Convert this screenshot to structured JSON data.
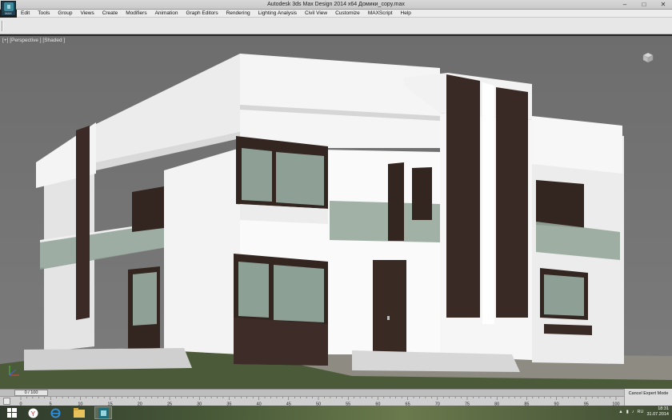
{
  "window": {
    "title": "Autodesk 3ds Max Design 2014 x64   Домики_copy.max",
    "app_icon_caption": "MAX",
    "controls": [
      "–",
      "□",
      "✕"
    ]
  },
  "menu": {
    "items": [
      "Edit",
      "Tools",
      "Group",
      "Views",
      "Create",
      "Modifiers",
      "Animation",
      "Graph Editors",
      "Rendering",
      "Lighting Analysis",
      "Civil View",
      "Customize",
      "MAXScript",
      "Help"
    ]
  },
  "viewport": {
    "label": "[+] [Perspective ] [Shaded ]"
  },
  "timeline": {
    "slider_text": "0 / 100",
    "ticks": [
      "0",
      "5",
      "10",
      "15",
      "20",
      "25",
      "30",
      "35",
      "40",
      "45",
      "50",
      "55",
      "60",
      "65",
      "70",
      "75",
      "80",
      "85",
      "90",
      "95",
      "100"
    ],
    "status_text": "Cancel Expert Mode"
  },
  "taskbar": {
    "lang": "RU",
    "time": "18:31",
    "date": "31.07.2014"
  },
  "colors": {
    "viewport_bg": "#747474",
    "wall": "#f2f2f2",
    "dark_wood": "#3b2a25",
    "glass": "#8fa196",
    "ground": "#4a5a38"
  }
}
